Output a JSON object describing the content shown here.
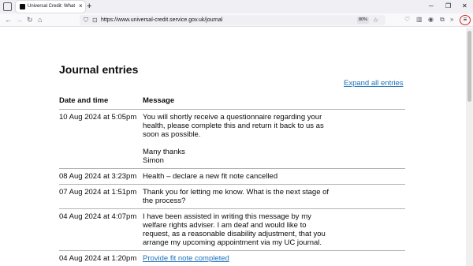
{
  "browser": {
    "tab_title": "Universal Credit: What Universa",
    "tab_close": "×",
    "new_tab": "+",
    "url": "https://www.universal-credit.service.gov.uk/journal",
    "zoom": "80%",
    "menu_glyph": "≡"
  },
  "page": {
    "title": "Journal entries",
    "expand_all": "Expand all entries",
    "table": {
      "headers": {
        "date": "Date and time",
        "message": "Message"
      },
      "rows": [
        {
          "date": "10 Aug 2024 at 5:05pm",
          "message": "You will shortly receive a questionnaire regarding your health, please complete this and return it back to us as soon as possible.",
          "signoff": "Many thanks",
          "signature": "Simon"
        },
        {
          "date": "08 Aug 2024 at 3:23pm",
          "message": "Health – declare a new fit note cancelled"
        },
        {
          "date": "07 Aug 2024 at 1:51pm",
          "message": "Thank you for letting me know. What is the next stage of the process?"
        },
        {
          "date": "04 Aug 2024 at 4:07pm",
          "message": "I have been assisted in writing this message by my welfare rights adviser. I am deaf and would like to request, as a reasonable disability adjustment, that you arrange my upcoming appointment via my UC journal."
        },
        {
          "date": "04 Aug 2024 at 1:20pm",
          "message": "Provide fit note completed"
        }
      ]
    }
  },
  "colors": {
    "link": "#1d70b8",
    "text": "#0b0c0c",
    "annotation": "#e0201c"
  }
}
